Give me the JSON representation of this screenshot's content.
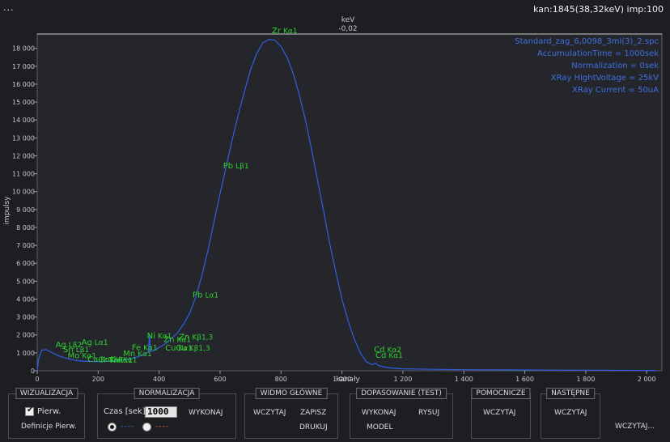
{
  "topbar": {
    "menu": "...",
    "status": "kan:1845(38,32keV) imp:100"
  },
  "chart_data": {
    "type": "line",
    "x_top_label": "keV",
    "x_top_value": "-0,02",
    "xlabel": "kanały",
    "ylabel": "impulsy",
    "xlim": [
      0,
      2050
    ],
    "ylim": [
      0,
      18800
    ],
    "x_ticks": [
      {
        "v": 0,
        "label": "0"
      },
      {
        "v": 200,
        "label": "200"
      },
      {
        "v": 400,
        "label": "400"
      },
      {
        "v": 600,
        "label": "600"
      },
      {
        "v": 800,
        "label": "800"
      },
      {
        "v": 1000,
        "label": "1 000"
      },
      {
        "v": 1200,
        "label": "1 200"
      },
      {
        "v": 1400,
        "label": "1 400"
      },
      {
        "v": 1600,
        "label": "1 600"
      },
      {
        "v": 1800,
        "label": "1 800"
      },
      {
        "v": 2000,
        "label": "2 000"
      }
    ],
    "y_ticks": [
      {
        "v": 0,
        "label": "0"
      },
      {
        "v": 1000,
        "label": "1 000"
      },
      {
        "v": 2000,
        "label": "2 000"
      },
      {
        "v": 3000,
        "label": "3 000"
      },
      {
        "v": 4000,
        "label": "4 000"
      },
      {
        "v": 5000,
        "label": "5 000"
      },
      {
        "v": 6000,
        "label": "6 000"
      },
      {
        "v": 7000,
        "label": "7 000"
      },
      {
        "v": 8000,
        "label": "8 000"
      },
      {
        "v": 9000,
        "label": "9 000"
      },
      {
        "v": 10000,
        "label": "10 000"
      },
      {
        "v": 11000,
        "label": "11 000"
      },
      {
        "v": 12000,
        "label": "12 000"
      },
      {
        "v": 13000,
        "label": "13 000"
      },
      {
        "v": 14000,
        "label": "14 000"
      },
      {
        "v": 15000,
        "label": "15 000"
      },
      {
        "v": 16000,
        "label": "16 000"
      },
      {
        "v": 17000,
        "label": "17 000"
      },
      {
        "v": 18000,
        "label": "18 000"
      }
    ],
    "info": [
      "Standard_zag_6,0098_3ml(3)_2.spc",
      "AccumulationTime = 1000sek",
      "Normalization = 0sek",
      "XRay HightVoltage = 25kV",
      "XRay Current = 50uA"
    ],
    "series": [
      {
        "color": "#2f5fe0",
        "x": [
          0,
          5,
          15,
          30,
          50,
          70,
          90,
          110,
          130,
          150,
          170,
          200,
          230,
          260,
          290,
          320,
          350,
          365,
          368,
          372,
          380,
          400,
          420,
          440,
          460,
          480,
          500,
          520,
          540,
          560,
          580,
          600,
          620,
          640,
          660,
          680,
          700,
          720,
          740,
          760,
          780,
          800,
          820,
          840,
          860,
          880,
          900,
          920,
          940,
          960,
          980,
          1000,
          1020,
          1040,
          1060,
          1080,
          1100,
          1110,
          1120,
          1140,
          1160,
          1180,
          1200,
          1300,
          1400,
          1600,
          1800,
          2000,
          2030
        ],
        "y": [
          0,
          700,
          1150,
          1180,
          1000,
          830,
          720,
          640,
          570,
          540,
          520,
          510,
          530,
          560,
          620,
          720,
          900,
          1050,
          2000,
          1100,
          1100,
          1300,
          1500,
          1800,
          2100,
          2600,
          3200,
          4100,
          5300,
          6700,
          8300,
          9900,
          11400,
          12900,
          14300,
          15600,
          16800,
          17700,
          18300,
          18500,
          18450,
          18100,
          17500,
          16600,
          15400,
          14000,
          12400,
          10600,
          8900,
          7100,
          5500,
          4000,
          2800,
          1800,
          1000,
          500,
          350,
          420,
          290,
          200,
          160,
          130,
          110,
          80,
          60,
          40,
          30,
          20,
          20
        ]
      }
    ],
    "peaks": [
      {
        "el": "Zr",
        "line": "Kα1",
        "x": 770,
        "y": 18850
      },
      {
        "el": "Pb",
        "line": "Lβ1",
        "x": 610,
        "y": 11300
      },
      {
        "el": "Pb",
        "line": "Lα1",
        "x": 510,
        "y": 4100
      },
      {
        "el": "Ag",
        "line": "Lα1",
        "x": 145,
        "y": 1450
      },
      {
        "el": "Ni",
        "line": "Kα1",
        "x": 360,
        "y": 1800
      },
      {
        "el": "Fe",
        "line": "Kα1",
        "x": 310,
        "y": 1150
      },
      {
        "el": "Mn",
        "line": "Kα1",
        "x": 282,
        "y": 820
      },
      {
        "el": "Zn",
        "line": "Kα1",
        "x": 415,
        "y": 1600
      },
      {
        "el": "Zn",
        "line": "Kβ1,3",
        "x": 465,
        "y": 1750
      },
      {
        "el": "Cu",
        "line": "Kα1",
        "x": 420,
        "y": 1120
      },
      {
        "el": "Cu",
        "line": "Kβ1,3",
        "x": 455,
        "y": 1120
      },
      {
        "el": "Cd",
        "line": "Kα2",
        "x": 1105,
        "y": 1050
      },
      {
        "el": "Cd",
        "line": "Kα1",
        "x": 1110,
        "y": 730
      },
      {
        "el": "Ag",
        "line": "Lβ2",
        "x": 60,
        "y": 1300
      },
      {
        "el": "Sn",
        "line": "Lβ1",
        "x": 85,
        "y": 1050
      },
      {
        "el": "Mo",
        "line": "Kα1",
        "x": 100,
        "y": 700
      },
      {
        "el": "Ca",
        "line": "Kα1",
        "x": 165,
        "y": 500
      },
      {
        "el": "Cr",
        "line": "Kα1",
        "x": 200,
        "y": 480
      },
      {
        "el": "Ti",
        "line": "Kα1",
        "x": 235,
        "y": 460
      },
      {
        "el": "V",
        "line": "Kα1",
        "x": 255,
        "y": 470
      }
    ]
  },
  "panel": {
    "wizualizacja": {
      "title": "WIZUALIZACJA",
      "checkbox_label": "Pierw.",
      "button": "Definicje Pierw."
    },
    "normalizacja": {
      "title": "NORMALIZACJA",
      "czas_label": "Czas [sek]",
      "czas_value": "1000",
      "button": "WYKONAJ",
      "radio1": "----",
      "radio2": "----",
      "radio1_color": "#3f6fe0",
      "radio2_color": "#e0702f"
    },
    "widmo": {
      "title": "WIDMO GŁÓWNE",
      "wczytaj": "WCZYTAJ",
      "zapisz": "ZAPISZ",
      "drukuj": "DRUKUJ"
    },
    "dopasowanie": {
      "title": "DOPASOWANIE (TEST)",
      "wykonaj": "WYKONAJ",
      "rysuj": "RYSUJ",
      "model": "MODEL"
    },
    "pomocnicze": {
      "title": "POMOCNICZE",
      "wczytaj": "WCZYTAJ"
    },
    "nastepne": {
      "title": "NASTĘPNE",
      "wczytaj": "WCZYTAJ"
    },
    "extra": {
      "wczytaj": "WCZYTAJ..."
    }
  }
}
